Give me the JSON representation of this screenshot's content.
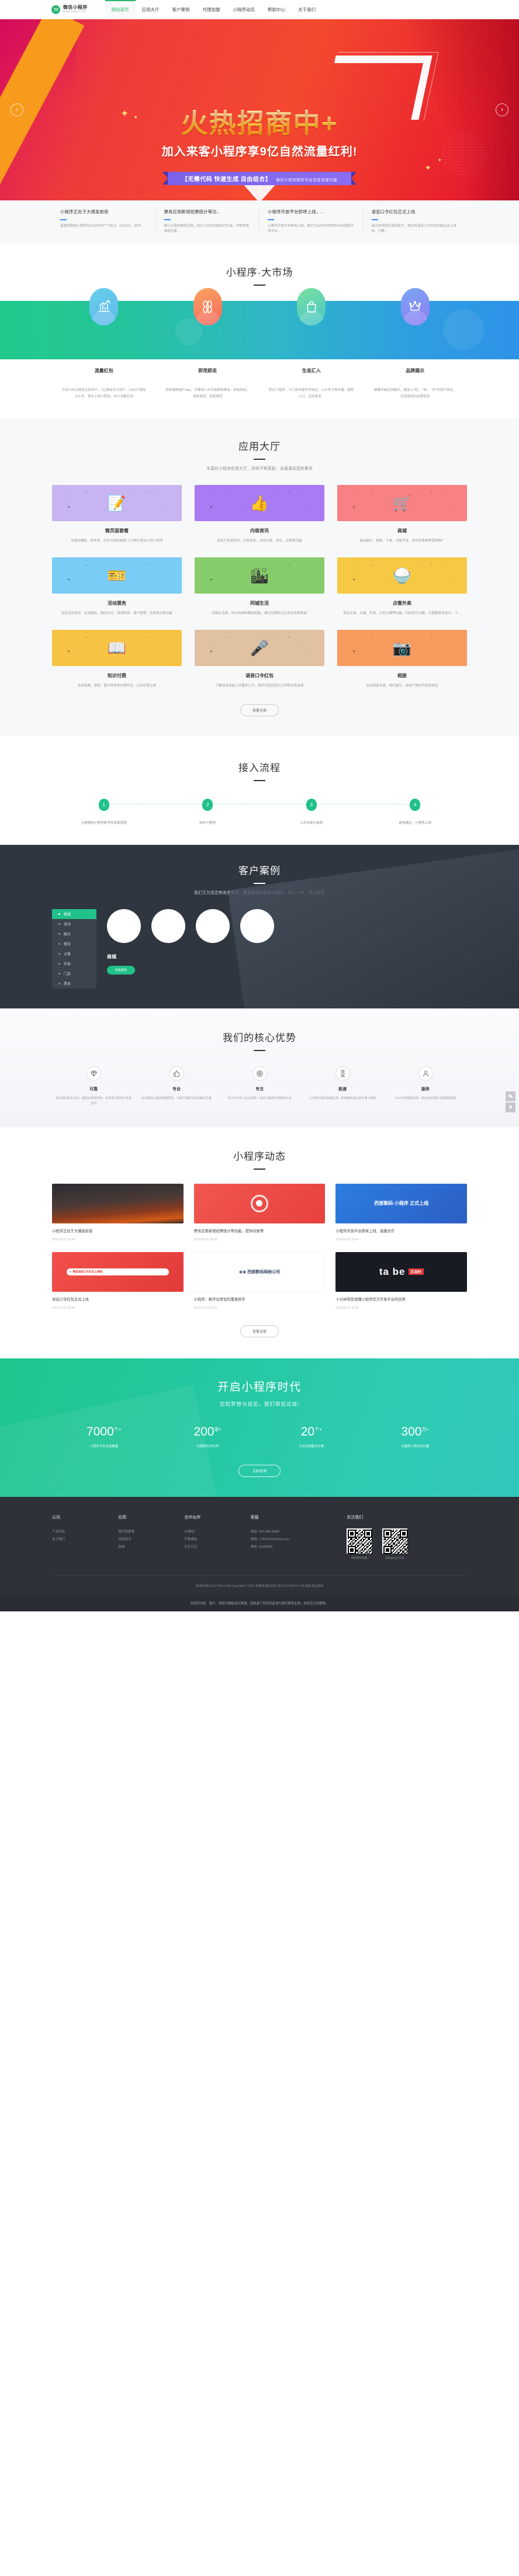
{
  "header": {
    "logo_title": "微信小程序",
    "logo_sub": "www.baiud.com",
    "logo_icon": "wechat-miniprogram-logo-icon",
    "nav": [
      {
        "label": "网站首页",
        "active": true
      },
      {
        "label": "应用大厅",
        "active": false
      },
      {
        "label": "客户案例",
        "active": false
      },
      {
        "label": "代理加盟",
        "active": false
      },
      {
        "label": "小程序动态",
        "active": false
      },
      {
        "label": "帮助中心",
        "active": false
      },
      {
        "label": "关于我们",
        "active": false
      }
    ]
  },
  "hero": {
    "title": "火热招商中",
    "title_plus": "+",
    "subtitle": "加入来客小程序享9亿自然流量红利!",
    "ribbon": "【无需代码  快速生成  自由组合】",
    "ribbon_small": "微信小程序制作平台百变无限可能",
    "prev_icon": "chevron-left-icon",
    "next_icon": "chevron-right-icon",
    "slides": 3,
    "active_slide": 0
  },
  "newsbar": [
    {
      "title": "小程序正处于大爆发前夜",
      "desc": "直播答题是小程序在2018年的**个风口。1月18日，新世.."
    },
    {
      "title": "票务应用新增验票统计等功...",
      "desc": "精心打造的票务应用，经过十余次功能迭代升级，不断的增强和完善..."
    },
    {
      "title": "小程序开放平台即将上线，...",
      "desc": "小程序开放平台即将上线，我们为合作伙伴提供OEM版和开放平台..."
    },
    {
      "title": "语音口令红包正式上线",
      "desc": "经过技术团队加班努力，咱们的语音口令红包功能正式上线啦，只要..."
    }
  ],
  "market": {
    "title": "小程序·大市场",
    "items": [
      {
        "label": "流量红包",
        "icon": "chart-growth-icon",
        "desc": "共享9.85亿微信注册用户，7亿微信支付用户，2000万微信公众号，率先上线小程序，抢占流量红利"
      },
      {
        "label": "即用即走",
        "icon": "four-leaf-icon",
        "desc": "拒绝满屏僵尸App，不要恼人的安装更新推送，即用即走，简单高效，就是潮范"
      },
      {
        "label": "生态汇入",
        "icon": "shopping-bag-icon",
        "desc": "附近小程序，与订阅号服务号绑定，公众号文章传播，搜索入口，还有更多..."
      },
      {
        "label": "品牌展示",
        "icon": "crown-icon",
        "desc": "颠覆传统应用模式，微信上\"轻\"、\"快\"、\"好\"的用户体验，实现高效的品牌宣传"
      }
    ]
  },
  "apphall": {
    "title": "应用大厅",
    "desc": "丰富的小程序应用大厅，持续不断更新，全面满足您的需求",
    "more_label": "查看全部",
    "cards": [
      {
        "name": "微页面套餐",
        "desc": "丰富的模板、组件库，完全可视化拖拽 三分钟打造自己的小程序",
        "bg": "#c7b4f0",
        "glyph": "📝",
        "icon": "page-builder-icon"
      },
      {
        "name": "内容资讯",
        "desc": "适用于各类资讯、内容发布，支持分类、评论、点赞等功能",
        "bg": "#a97bf5",
        "glyph": "👍",
        "icon": "news-thumb-icon"
      },
      {
        "name": "商城",
        "desc": "商品展示、搜索、下单、功能齐全，支持优惠券等营销推广",
        "bg": "#f88183",
        "glyph": "🛒",
        "icon": "shop-cart-icon"
      },
      {
        "name": "活动票务",
        "desc": "支持活动发布、在线报名、微信支付、快速核销、客户管理、名单导出等功能",
        "bg": "#79ccf5",
        "glyph": "🎫",
        "icon": "ticket-chart-icon"
      },
      {
        "name": "同城生活",
        "desc": "同城生活圈，地方自媒体赚钱利器，通过互联网让生活变得更简单!",
        "bg": "#87cc6b",
        "glyph": "🏙",
        "icon": "city-location-icon"
      },
      {
        "name": "点餐外卖",
        "desc": "具有买单、点餐、外卖、打印小票等功能，扫码即可点餐，无需服务员参与，下…",
        "bg": "#f6c945",
        "glyph": "🍚",
        "icon": "order-food-icon"
      },
      {
        "name": "知识付费",
        "desc": "支持音频、视频、图文等多种付费形式，让知识更立体",
        "bg": "#f7c344",
        "glyph": "📖",
        "icon": "book-video-icon"
      },
      {
        "name": "语音口令红包",
        "desc": "只要说出发起人设置的口令，程序识别后就可以领取到赏金哦",
        "bg": "#e0c1a1",
        "glyph": "🎤",
        "icon": "voice-redpacket-icon"
      },
      {
        "name": "相册",
        "desc": "支持相册分类、相片展示，给用户更好的视觉体验",
        "bg": "#f79b5e",
        "glyph": "📷",
        "icon": "photo-camera-icon"
      }
    ]
  },
  "process": {
    "title": "接入流程",
    "steps": [
      {
        "num": "1",
        "text": "注册微信小程序账号并获取密钥"
      },
      {
        "num": "2",
        "text": "制作小程序"
      },
      {
        "num": "3",
        "text": "上传并提交审核"
      },
      {
        "num": "4",
        "text": "审核通过，小程序上线"
      }
    ]
  },
  "cases": {
    "title": "客户案例",
    "desc": "我们又为您定制各类案例，教育院校科技类小程序，快人一步，抢占先机",
    "menu": [
      {
        "label": "商城",
        "active": true
      },
      {
        "label": "资讯",
        "active": false
      },
      {
        "label": "展示",
        "active": false
      },
      {
        "label": "餐饮",
        "active": false
      },
      {
        "label": "点餐",
        "active": false
      },
      {
        "label": "外卖",
        "active": false
      },
      {
        "label": "门店",
        "active": false
      },
      {
        "label": "票务",
        "active": false
      }
    ],
    "caption": "商城",
    "button": "查看案例",
    "circles": 4
  },
  "advantage": {
    "title": "我们的核心优势",
    "items": [
      {
        "name": "可靠",
        "icon": "diamond-icon",
        "desc": "多年团队技术沉淀，超稳定系统架构，支持百万级用户并发访问"
      },
      {
        "name": "专业",
        "icon": "thumb-up-icon",
        "desc": "专注微信小程序领域研发，为客户提供专业的解决方案"
      },
      {
        "name": "专注",
        "icon": "target-icon",
        "desc": "专注于为中小企业提供一站式小程序开发服务平台"
      },
      {
        "name": "极速",
        "icon": "hourglass-icon",
        "desc": "三分钟可视化快速生成，即刻拥有自己的专属小程序"
      },
      {
        "name": "服务",
        "icon": "user-service-icon",
        "desc": "7x24小时客服在线，专业技术团队全程跟进服务"
      }
    ]
  },
  "newsection": {
    "title": "小程序动态",
    "more_label": "查看全部",
    "cards": [
      {
        "title": "小程序正处于大爆发前夜",
        "date": "2018-02-02 16:49",
        "thumb": "volcano",
        "thumb_text": "",
        "icon": "volcano-photo-icon"
      },
      {
        "title": "票务应用新增验票统计等功能，提供对账等",
        "date": "2018-02-02 16:48",
        "thumb": "green",
        "thumb_text": "",
        "icon": "green-ring-icon"
      },
      {
        "title": "小程序开放平台即将上线，诚邀合作",
        "date": "2018-02-02 16:47",
        "thumb": "blue",
        "thumb_text": "西部聚码·小程序 正式上线",
        "icon": "blue-banner-icon"
      },
      {
        "title": "语音口令红包正式上线",
        "date": "2018-02-02 16:45",
        "thumb": "red",
        "thumb_text": "",
        "icon": "red-packet-icon"
      },
      {
        "title": "小程序：数字化转型的重要抓手",
        "date": "2018-02-02 16:42",
        "thumb": "white",
        "thumb_text": "",
        "icon": "company-logo-icon"
      },
      {
        "title": "十分钟带您读懂小程序官方开发平台的优势",
        "date": "2018-02-02 16:40",
        "thumb": "dark",
        "thumb_text": "ta be",
        "icon": "tabe-logo-icon",
        "badge": "正当时"
      }
    ]
  },
  "cta": {
    "title": "开启小程序时代",
    "subtitle": "您的梦想与远见，我们帮您达成!",
    "button": "立即咨询",
    "stats": [
      {
        "num": "7000",
        "sup": "个+",
        "label": "小程序平台生成数量"
      },
      {
        "num": "200",
        "sup": "家+",
        "label": "代理商合作伙伴"
      },
      {
        "num": "20",
        "sup": "个+",
        "label": "行业应用解决方案"
      },
      {
        "num": "300",
        "sup": "万+",
        "label": "日服务小程序访问量"
      }
    ]
  },
  "footer": {
    "columns": [
      {
        "head": "公司",
        "links": [
          "产品动态",
          "关于我们"
        ]
      },
      {
        "head": "应用",
        "links": [
          "微页面套餐",
          "内容资讯",
          "商城"
        ]
      },
      {
        "head": "合作伙伴",
        "links": [
          "92建站",
          "齐鲁建站",
          "花生日记"
        ]
      },
      {
        "head": "客服",
        "links": [
          "电话: 400-888-8888",
          "邮箱: 778412468@qq.com",
          "微信: Wx88888"
        ]
      }
    ],
    "follow_head": "关注我们",
    "qr": [
      {
        "caption": "- 扫码到手机版 -",
        "icon": "qr-code-icon"
      },
      {
        "caption": "- 扫码关注公众号 -",
        "icon": "qr-code-icon"
      }
    ],
    "copyright": "[本源码演示QQ778412468] Copyright © 2021 某某网 版权所有 苏ICP12345678 XML地图 网站源码",
    "note": "本网页内容、图片、视频为模板演示数据，若损害了您的利益请与我们联系反馈，核实后立即删除。"
  },
  "sidetools": [
    {
      "icon": "wechat-icon"
    },
    {
      "icon": "bell-icon"
    }
  ]
}
